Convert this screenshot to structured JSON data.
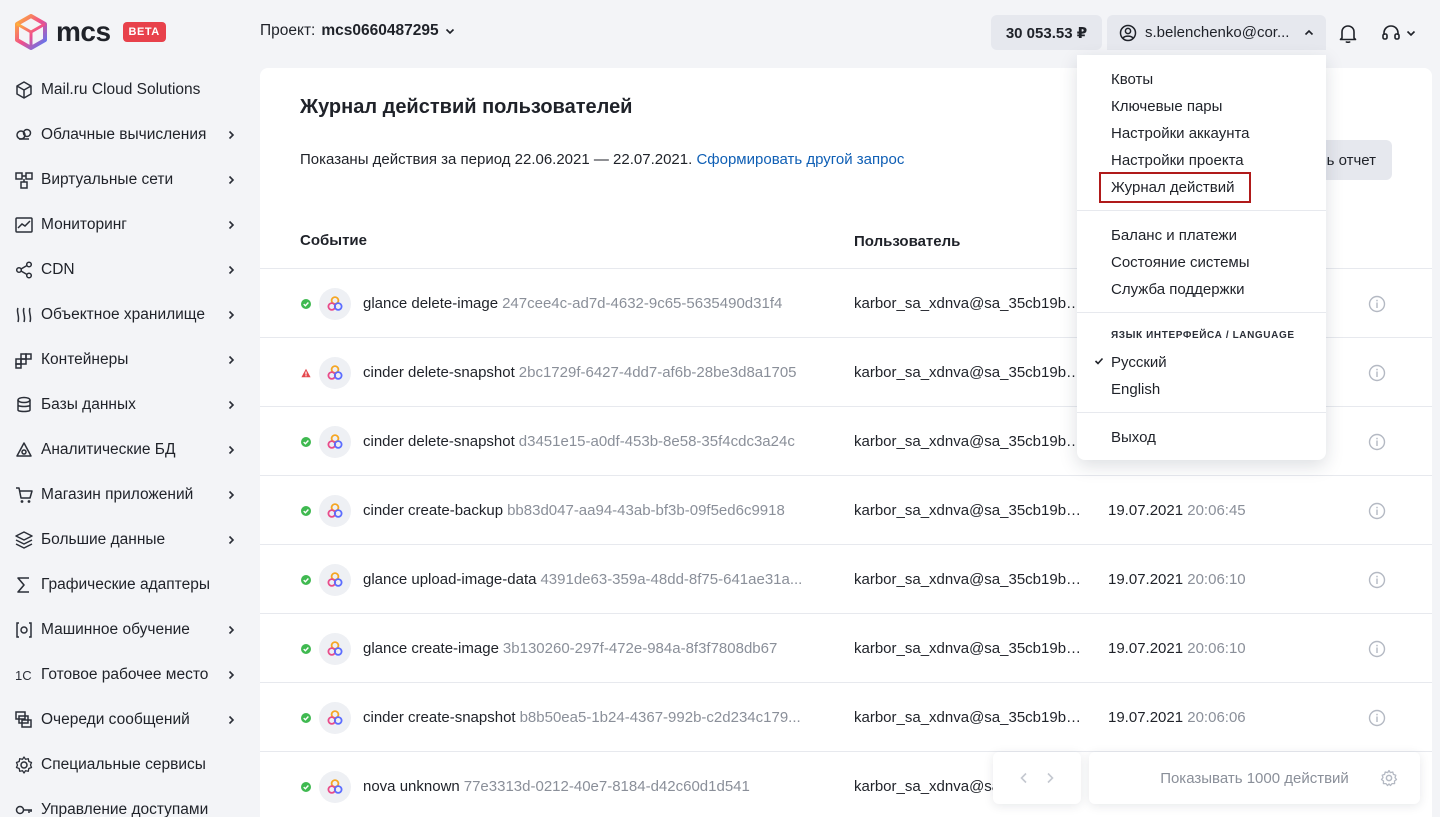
{
  "brand": {
    "name": "mcs",
    "badge": "BETA"
  },
  "sidebar": {
    "items": [
      {
        "label": "Mail.ru Cloud Solutions",
        "icon": "cube-icon",
        "chevron": false
      },
      {
        "label": "Облачные вычисления",
        "icon": "cloud-compute-icon",
        "chevron": true
      },
      {
        "label": "Виртуальные сети",
        "icon": "network-icon",
        "chevron": true
      },
      {
        "label": "Мониторинг",
        "icon": "chart-line-icon",
        "chevron": true
      },
      {
        "label": "CDN",
        "icon": "share-nodes-icon",
        "chevron": true
      },
      {
        "label": "Объектное хранилище",
        "icon": "storage-waves-icon",
        "chevron": true
      },
      {
        "label": "Контейнеры",
        "icon": "containers-icon",
        "chevron": true
      },
      {
        "label": "Базы данных",
        "icon": "database-icon",
        "chevron": true
      },
      {
        "label": "Аналитические БД",
        "icon": "analytics-db-icon",
        "chevron": true
      },
      {
        "label": "Магазин приложений",
        "icon": "cart-icon",
        "chevron": true
      },
      {
        "label": "Большие данные",
        "icon": "layers-icon",
        "chevron": true
      },
      {
        "label": "Графические адаптеры",
        "icon": "sigma-icon",
        "chevron": false
      },
      {
        "label": "Машинное обучение",
        "icon": "ml-icon",
        "chevron": true
      },
      {
        "label": "Готовое рабочее место",
        "icon": "1c-icon",
        "chevron": true
      },
      {
        "label": "Очереди сообщений",
        "icon": "queue-icon",
        "chevron": true
      },
      {
        "label": "Специальные сервисы",
        "icon": "gear-icon",
        "chevron": false
      },
      {
        "label": "Управление доступами",
        "icon": "key-icon",
        "chevron": false
      }
    ]
  },
  "header": {
    "project_label": "Проект:",
    "project_name": "mcs0660487295",
    "balance": "30 053.53 ₽",
    "account": "s.belenchenko@cor..."
  },
  "main": {
    "title": "Журнал действий пользователей",
    "period_text": "Показаны действия за период 22.06.2021 — 22.07.2021.",
    "period_link": "Сформировать другой запрос",
    "report_button": "ь отчет",
    "columns": {
      "event": "Событие",
      "user": "Пользователь"
    },
    "rows": [
      {
        "status": "ok",
        "event": "glance delete-image",
        "id": "247cee4c-ad7d-4632-9c65-5635490d31f4",
        "user": "karbor_sa_xdnva@sa_35cb19b6...",
        "date": "",
        "time": ""
      },
      {
        "status": "warn",
        "event": "cinder delete-snapshot",
        "id": "2bc1729f-6427-4dd7-af6b-28be3d8a1705",
        "user": "karbor_sa_xdnva@sa_35cb19b6...",
        "date": "",
        "time": ""
      },
      {
        "status": "ok",
        "event": "cinder delete-snapshot",
        "id": "d3451e15-a0df-453b-8e58-35f4cdc3a24c",
        "user": "karbor_sa_xdnva@sa_35cb19b6...",
        "date": "",
        "time": ""
      },
      {
        "status": "ok",
        "event": "cinder create-backup",
        "id": "bb83d047-aa94-43ab-bf3b-09f5ed6c9918",
        "user": "karbor_sa_xdnva@sa_35cb19b6...",
        "date": "19.07.2021",
        "time": "20:06:45"
      },
      {
        "status": "ok",
        "event": "glance upload-image-data",
        "id": "4391de63-359a-48dd-8f75-641ae31a...",
        "user": "karbor_sa_xdnva@sa_35cb19b6...",
        "date": "19.07.2021",
        "time": "20:06:10"
      },
      {
        "status": "ok",
        "event": "glance create-image",
        "id": "3b130260-297f-472e-984a-8f3f7808db67",
        "user": "karbor_sa_xdnva@sa_35cb19b6...",
        "date": "19.07.2021",
        "time": "20:06:10"
      },
      {
        "status": "ok",
        "event": "cinder create-snapshot",
        "id": "b8b50ea5-1b24-4367-992b-c2d234c179...",
        "user": "karbor_sa_xdnva@sa_35cb19b6...",
        "date": "19.07.2021",
        "time": "20:06:06"
      },
      {
        "status": "ok",
        "event": "nova unknown",
        "id": "77e3313d-0212-40e7-8184-d42c60d1d541",
        "user": "karbor_sa_xdnva@sa",
        "date": "",
        "time": ""
      }
    ]
  },
  "dropdown": {
    "group1": [
      "Квоты",
      "Ключевые пары",
      "Настройки аккаунта",
      "Настройки проекта",
      "Журнал действий"
    ],
    "group2": [
      "Баланс и платежи",
      "Состояние системы",
      "Служба поддержки"
    ],
    "language_title": "ЯЗЫК ИНТЕРФЕЙСА / LANGUAGE",
    "languages": [
      "Русский",
      "English"
    ],
    "logout": "Выход"
  },
  "footer": {
    "per_page": "Показывать 1000 действий"
  },
  "colors": {
    "accent_red": "#e8414b",
    "ok_green": "#3fb950",
    "warn_red": "#e5484d",
    "link_blue": "#0f5fb5"
  }
}
